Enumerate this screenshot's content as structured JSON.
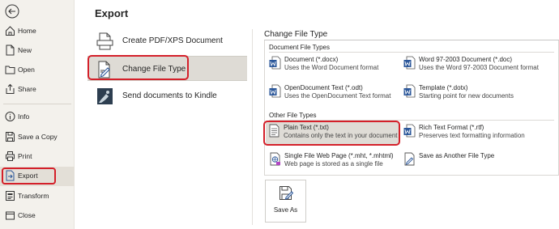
{
  "sidebar": {
    "items": [
      {
        "label": "Home"
      },
      {
        "label": "New"
      },
      {
        "label": "Open"
      },
      {
        "label": "Share"
      },
      {
        "label": "Info"
      },
      {
        "label": "Save a Copy"
      },
      {
        "label": "Print"
      },
      {
        "label": "Export"
      },
      {
        "label": "Transform"
      },
      {
        "label": "Close"
      }
    ]
  },
  "main": {
    "title": "Export",
    "options": [
      {
        "label": "Create PDF/XPS Document"
      },
      {
        "label": "Change File Type"
      },
      {
        "label": "Send documents to Kindle"
      }
    ]
  },
  "panel": {
    "title": "Change File Type",
    "document_group": "Document File Types",
    "other_group": "Other File Types",
    "types": [
      {
        "name": "Document (*.docx)",
        "desc": "Uses the Word Document format"
      },
      {
        "name": "Word 97-2003 Document (*.doc)",
        "desc": "Uses the Word 97-2003 Document format"
      },
      {
        "name": "OpenDocument Text (*.odt)",
        "desc": "Uses the OpenDocument Text format"
      },
      {
        "name": "Template (*.dotx)",
        "desc": "Starting point for new documents"
      },
      {
        "name": "Plain Text (*.txt)",
        "desc": "Contains only the text in your document"
      },
      {
        "name": "Rich Text Format (*.rtf)",
        "desc": "Preserves text formatting information"
      },
      {
        "name": "Single File Web Page (*.mht, *.mhtml)",
        "desc": "Web page is stored as a single file"
      },
      {
        "name": "Save as Another File Type",
        "desc": ""
      }
    ],
    "save_as_label": "Save As"
  },
  "colors": {
    "highlight": "#d4202a",
    "word_blue": "#2b579a",
    "sidebar_bg": "#f3f1ec"
  }
}
